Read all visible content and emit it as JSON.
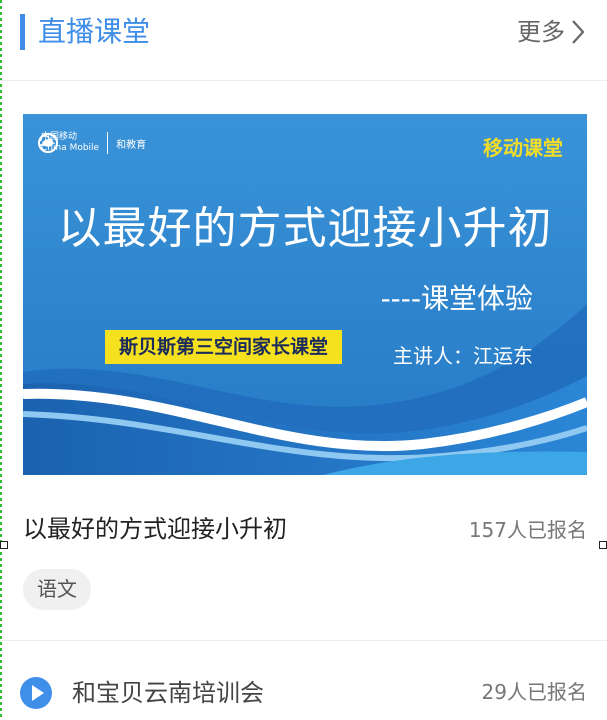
{
  "header": {
    "title": "直播课堂",
    "more_label": "更多"
  },
  "banner": {
    "logo_brand": "中国移动",
    "logo_brand_en": "China Mobile",
    "logo_edu": "和教育",
    "corner_label": "移动课堂",
    "headline": "以最好的方式迎接小升初",
    "subline": "----课堂体验",
    "tag": "斯贝斯第三空间家长课堂",
    "speaker": "主讲人：江运东"
  },
  "featured_course": {
    "title": "以最好的方式迎接小升初",
    "enrolled": "157人已报名",
    "subject_tag": "语文"
  },
  "list": [
    {
      "title": "和宝贝云南培训会",
      "enrolled": "29人已报名",
      "icon": "play-icon"
    }
  ],
  "colors": {
    "accent": "#3f8ee8",
    "banner_blue": "#2f86cf",
    "tag_yellow": "#f5e11e"
  }
}
